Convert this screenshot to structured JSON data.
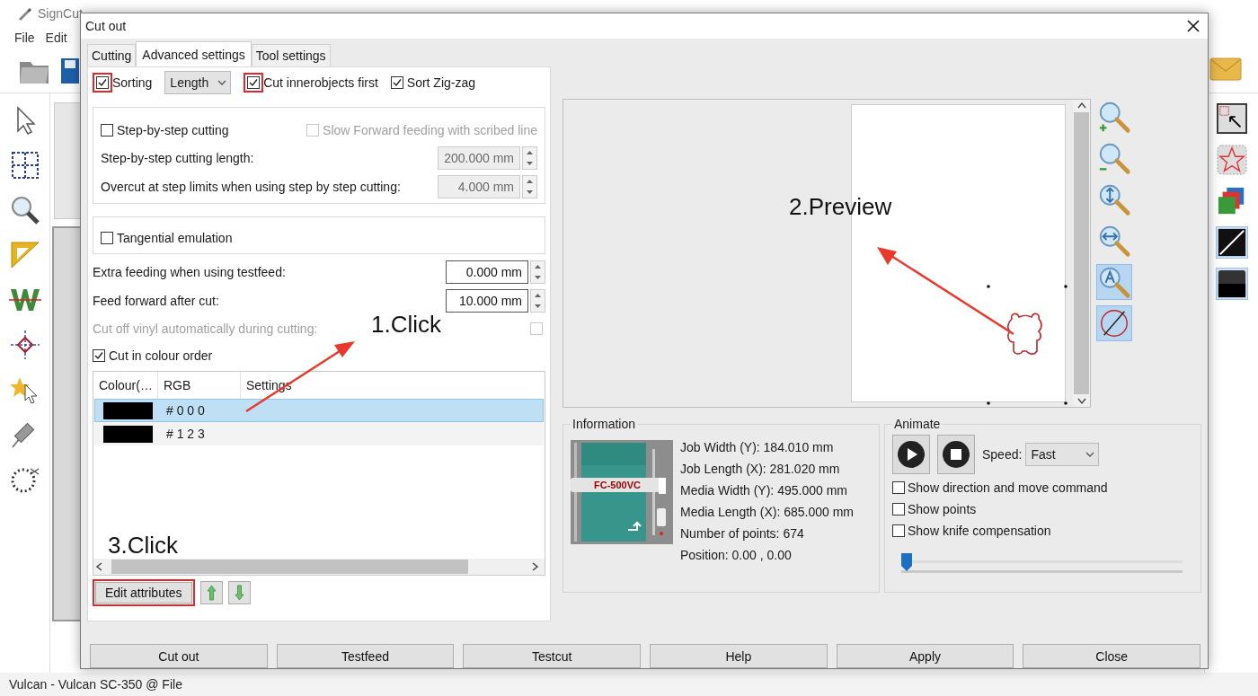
{
  "app": {
    "title": "SignCut",
    "menu": [
      {
        "label": "File"
      },
      {
        "label": "Edit"
      }
    ],
    "left_tools": [
      {
        "kind": "pointer"
      },
      {
        "kind": "grid"
      },
      {
        "kind": "magnifier"
      },
      {
        "kind": "ruler"
      },
      {
        "kind": "w-letter"
      },
      {
        "kind": "crosshair"
      },
      {
        "kind": "star-pointer"
      },
      {
        "kind": "knife"
      },
      {
        "kind": "dotted-circle"
      }
    ],
    "right_tools": [
      {
        "kind": "select-frame",
        "selected": false
      },
      {
        "kind": "star",
        "selected": false
      },
      {
        "kind": "layers",
        "selected": false
      },
      {
        "kind": "diagonal",
        "selected": true
      },
      {
        "kind": "black-square",
        "selected": true
      }
    ],
    "status": "Vulcan - Vulcan SC-350 @ File"
  },
  "dialog": {
    "title": "Cut out",
    "tabs": [
      {
        "label": "Cutting",
        "selected": false
      },
      {
        "label": "Advanced settings",
        "selected": true
      },
      {
        "label": "Tool settings",
        "selected": false
      }
    ],
    "top_row": [
      {
        "kind": "check",
        "label": "Sorting",
        "checked": true,
        "highlighted": true
      },
      {
        "kind": "select",
        "value": "Length"
      },
      {
        "kind": "check",
        "label": "Cut innerobjects first",
        "checked": true,
        "highlighted": true
      },
      {
        "kind": "check",
        "label": "Sort Zig-zag",
        "checked": true,
        "highlighted": false
      }
    ],
    "step_group": {
      "checks": [
        {
          "label": "Step-by-step cutting",
          "checked": false,
          "disabled": false
        },
        {
          "label": "Slow Forward feeding with scribed line",
          "checked": false,
          "disabled": true
        }
      ],
      "fields": [
        {
          "label": "Step-by-step cutting length:",
          "value": "200.000 mm",
          "disabled": true
        },
        {
          "label": "Overcut at step limits when using step by step cutting:",
          "value": "4.000 mm",
          "disabled": true
        }
      ]
    },
    "tangential": {
      "label": "Tangential emulation",
      "checked": false
    },
    "feed_fields": [
      {
        "label": "Extra feeding when using testfeed:",
        "value": "0.000 mm",
        "disabled": false
      },
      {
        "label": "Feed forward after cut:",
        "value": "10.000 mm",
        "disabled": false
      }
    ],
    "auto_cut": {
      "label": "Cut off vinyl automatically during cutting:",
      "checked": false,
      "disabled": true
    },
    "colour_order": {
      "label": "Cut in colour order",
      "checked": true
    },
    "colour_table": {
      "columns": [
        "Colour(…",
        "RGB",
        "Settings"
      ],
      "rows": [
        {
          "color": "#000000",
          "rgb": "# 0 0 0",
          "selected": true
        },
        {
          "color": "#000000",
          "rgb": "# 1 2 3",
          "selected": false
        }
      ]
    },
    "edit_button": {
      "label": "Edit attributes",
      "highlighted": true
    },
    "preview_tools": [
      {
        "kind": "zoom-in",
        "selected": false
      },
      {
        "kind": "zoom-out",
        "selected": false
      },
      {
        "kind": "zoom-height",
        "selected": false
      },
      {
        "kind": "zoom-width",
        "selected": false
      },
      {
        "kind": "zoom-auto",
        "selected": true
      },
      {
        "kind": "no-grid",
        "selected": true
      }
    ],
    "information": {
      "title": "Information",
      "device_label": "FC-500VC",
      "lines": [
        "Job Width (Y): 184.010 mm",
        "Job Length (X): 281.020 mm",
        "Media Width (Y): 495.000 mm",
        "Media Length (X): 685.000 mm",
        "Number of points: 674",
        "Position: 0.00 , 0.00"
      ]
    },
    "animate": {
      "title": "Animate",
      "speed_label": "Speed:",
      "speed": "Fast",
      "checks": [
        {
          "label": "Show direction and move command",
          "checked": false
        },
        {
          "label": "Show points",
          "checked": false
        },
        {
          "label": "Show knife compensation",
          "checked": false
        }
      ],
      "level": 0
    },
    "buttons": [
      {
        "label": "Cut out"
      },
      {
        "label": "Testfeed"
      },
      {
        "label": "Testcut"
      },
      {
        "label": "Help"
      },
      {
        "label": "Apply"
      },
      {
        "label": "Close"
      }
    ]
  },
  "annotations": [
    {
      "text": "1.Click"
    },
    {
      "text": "2.Preview"
    },
    {
      "text": "3.Click"
    }
  ]
}
